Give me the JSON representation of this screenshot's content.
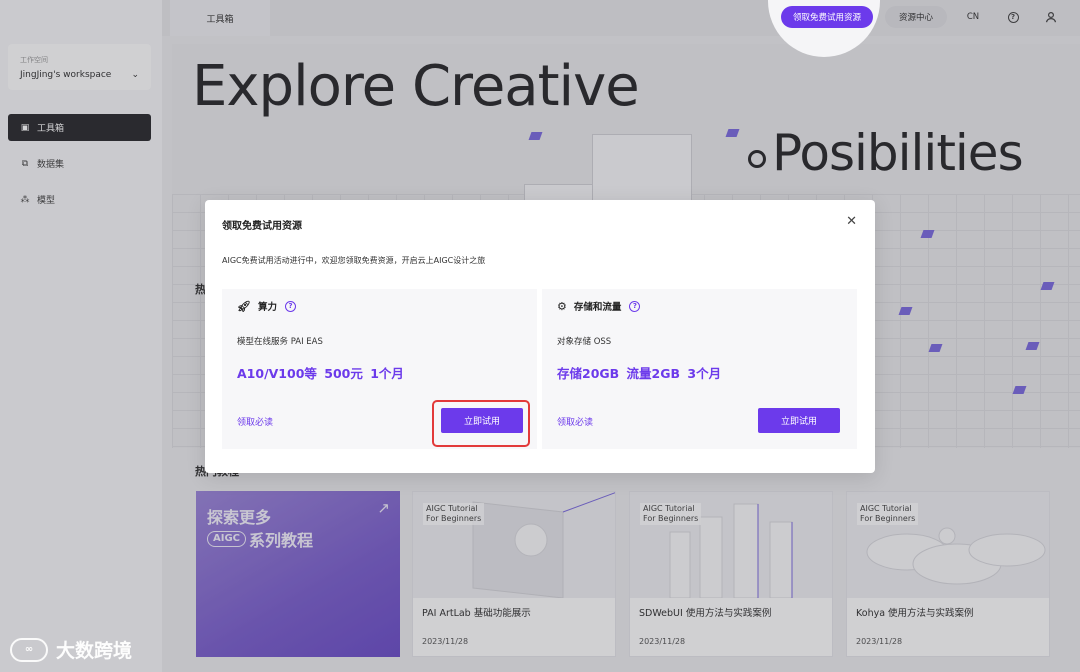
{
  "sidebar": {
    "workspace_label": "工作空间",
    "workspace_name": "JingJing's workspace",
    "items": [
      {
        "label": "工具箱",
        "icon": "toolbox-icon",
        "active": true
      },
      {
        "label": "数据集",
        "icon": "dataset-icon",
        "active": false
      },
      {
        "label": "模型",
        "icon": "model-icon",
        "active": false
      }
    ]
  },
  "topbar": {
    "tab": "工具箱",
    "trial_button": "领取免费试用资源",
    "resources_button": "资源中心",
    "lang": "CN",
    "help_icon": "help-icon",
    "user_icon": "user-icon"
  },
  "hero": {
    "line1": "Explore Creative",
    "line2": "Posibilities"
  },
  "sections": {
    "hot_tools": "热",
    "hot_tutorials": "热门教程"
  },
  "promo": {
    "line1": "探索更多",
    "badge": "AIGC",
    "line2": "系列教程"
  },
  "tutorials": [
    {
      "badge_line1": "AIGC Tutorial",
      "badge_line2": "For Beginners",
      "title": "PAI ArtLab 基础功能展示",
      "date": "2023/11/28"
    },
    {
      "badge_line1": "AIGC Tutorial",
      "badge_line2": "For Beginners",
      "title": "SDWebUI 使用方法与实践案例",
      "date": "2023/11/28"
    },
    {
      "badge_line1": "AIGC Tutorial",
      "badge_line2": "For Beginners",
      "title": "Kohya 使用方法与实践案例",
      "date": "2023/11/28"
    }
  ],
  "modal": {
    "title": "领取免费试用资源",
    "description": "AIGC免费试用活动进行中，欢迎您领取免费资源，开启云上AIGC设计之旅",
    "panels": [
      {
        "heading": "算力",
        "icon": "rocket-icon",
        "subtitle": "模型在线服务 PAI EAS",
        "offer": "A10/V100等 500元 1个月",
        "link": "领取必读",
        "button": "立即试用"
      },
      {
        "heading": "存储和流量",
        "icon": "storage-icon",
        "subtitle": "对象存储 OSS",
        "offer": "存储20GB  流量2GB   3个月",
        "link": "领取必读",
        "button": "立即试用"
      }
    ]
  },
  "watermark": "大数跨境",
  "colors": {
    "accent": "#6c3aeb",
    "highlight": "#e23a3a",
    "sidebar_active": "#2b2b2f"
  }
}
